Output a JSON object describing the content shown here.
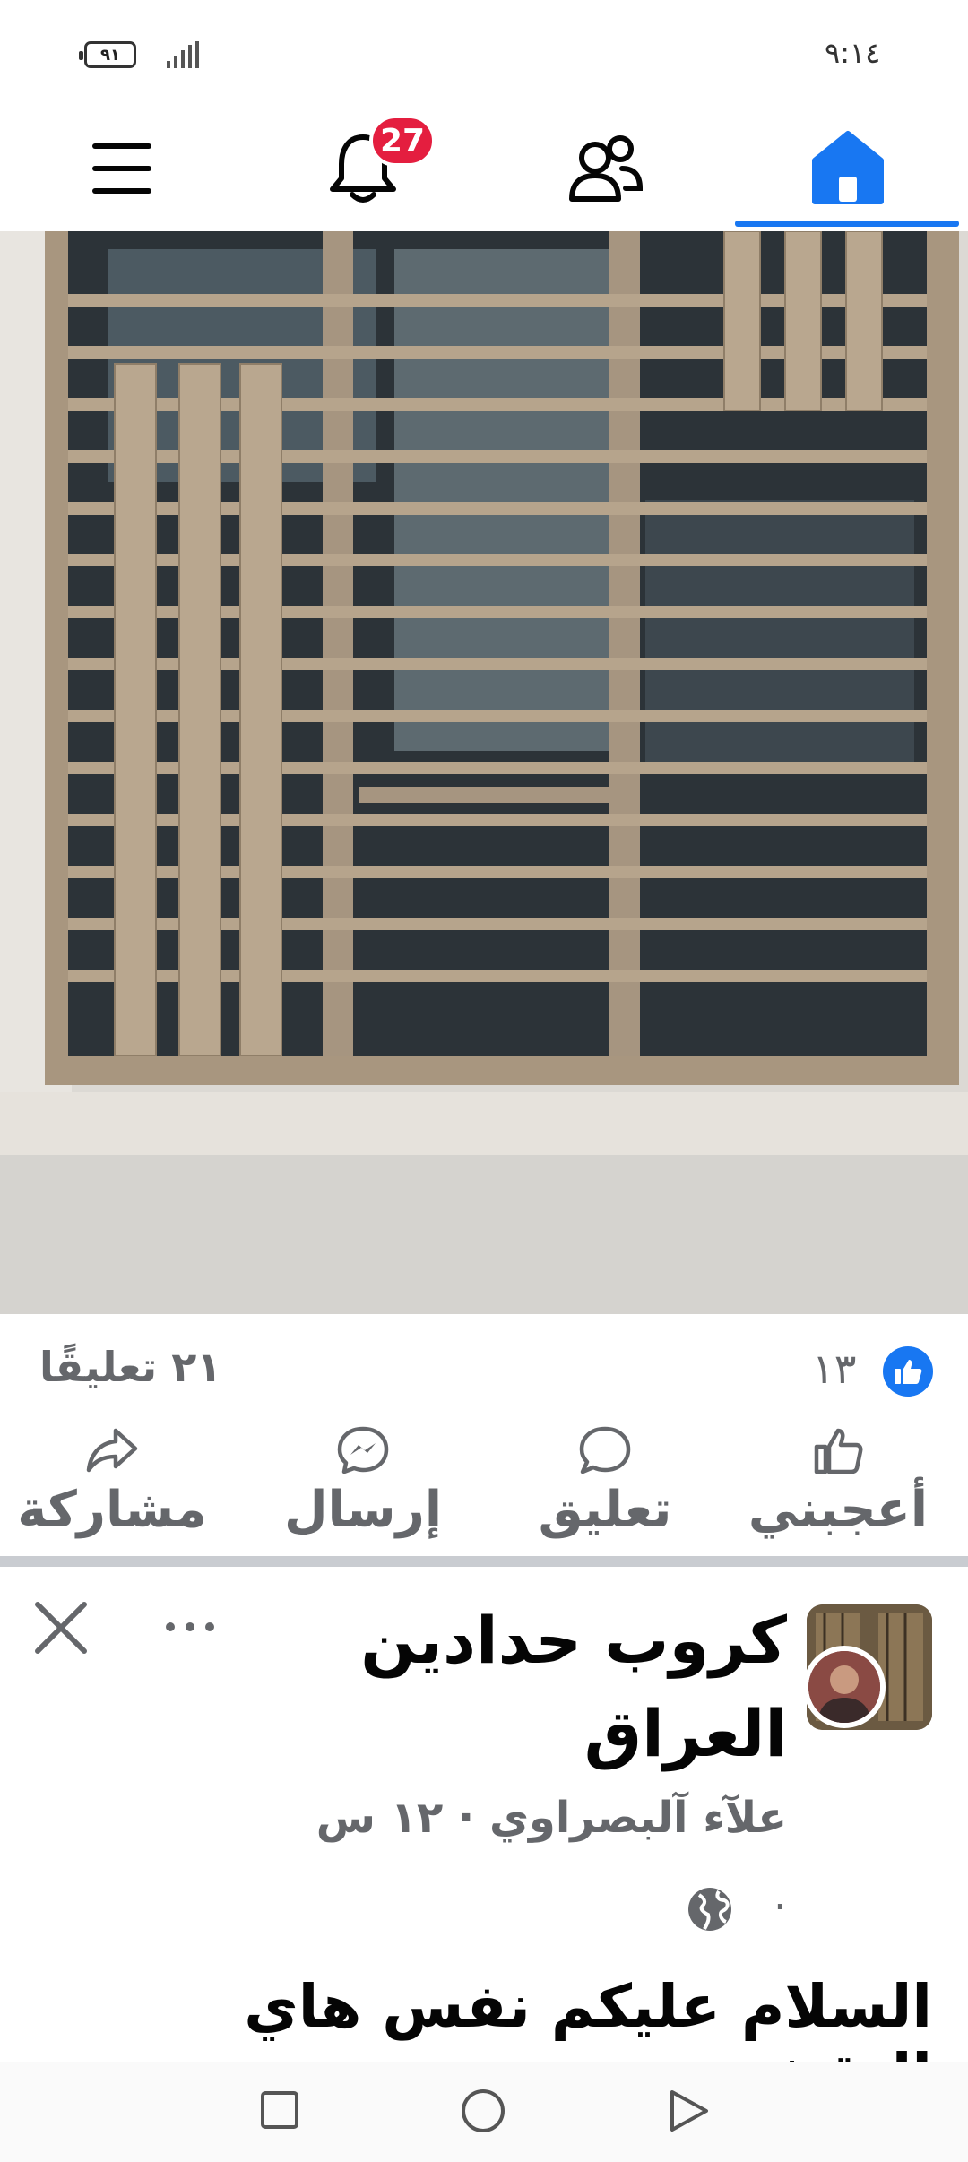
{
  "status_bar": {
    "battery": "٩١",
    "time": "٩:١٤",
    "icons": [
      "battery-icon",
      "signal-icon"
    ]
  },
  "nav": {
    "items": [
      "menu-icon",
      "notifications-icon",
      "friends-icon",
      "home-icon"
    ],
    "notifications_badge": "27",
    "active": "home",
    "accent_color": "#1877f2",
    "badge_color": "#e41e3f"
  },
  "post": {
    "likes": "١٣",
    "comments": "٢١ تعليقًا",
    "actions": {
      "like": "أعجبني",
      "comment": "تعليق",
      "send": "إرسال",
      "share": "مشاركة"
    }
  },
  "next_post": {
    "group_name": "كروب حدادين العراق",
    "author_line": "علآء آلبصراوي · ١٢ س",
    "privacy_dot": "·",
    "text": "السلام عليكم نفس هاي النقشة"
  },
  "system_nav": [
    "recents-icon",
    "home-circle-icon",
    "back-triangle-icon"
  ]
}
